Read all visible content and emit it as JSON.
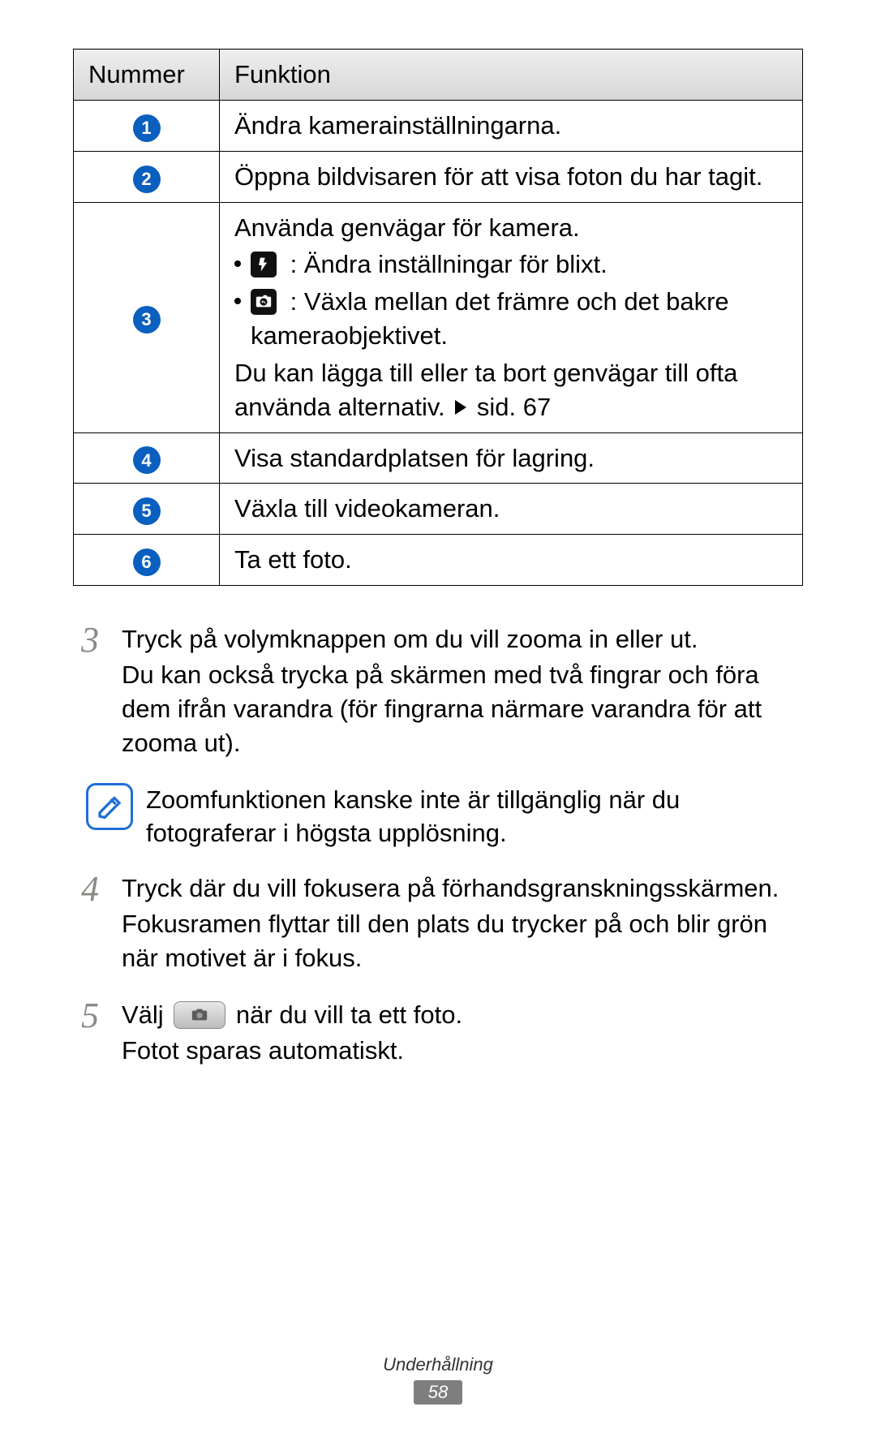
{
  "table": {
    "head_num": "Nummer",
    "head_fun": "Funktion",
    "rows": {
      "r1": {
        "num": "1",
        "text": "Ändra kamerainställningarna."
      },
      "r2": {
        "num": "2",
        "text": "Öppna bildvisaren för att visa foton du har tagit."
      },
      "r3": {
        "num": "3",
        "intro": "Använda genvägar för kamera.",
        "b1": " : Ändra inställningar för blixt.",
        "b2": " : Växla mellan det främre och det bakre kameraobjektivet.",
        "outro_a": "Du kan lägga till eller ta bort genvägar till ofta använda alternativ. ",
        "outro_b": " sid. 67"
      },
      "r4": {
        "num": "4",
        "text": "Visa standardplatsen för lagring."
      },
      "r5": {
        "num": "5",
        "text": "Växla till videokameran."
      },
      "r6": {
        "num": "6",
        "text": "Ta ett foto."
      }
    }
  },
  "steps": {
    "s3": {
      "num": "3",
      "p1": "Tryck på volymknappen om du vill zooma in eller ut.",
      "p2": "Du kan också trycka på skärmen med två fingrar och föra dem ifrån varandra (för fingrarna närmare varandra för att zooma ut)."
    },
    "note": "Zoomfunktionen kanske inte är tillgänglig när du fotograferar i högsta upplösning.",
    "s4": {
      "num": "4",
      "p1": "Tryck där du vill fokusera på förhandsgranskningsskärmen.",
      "p2": "Fokusramen flyttar till den plats du trycker på och blir grön när motivet är i fokus."
    },
    "s5": {
      "num": "5",
      "p1_a": "Välj ",
      "p1_b": " när du vill ta ett foto.",
      "p2": "Fotot sparas automatiskt."
    }
  },
  "footer": {
    "section": "Underhållning",
    "page": "58"
  }
}
